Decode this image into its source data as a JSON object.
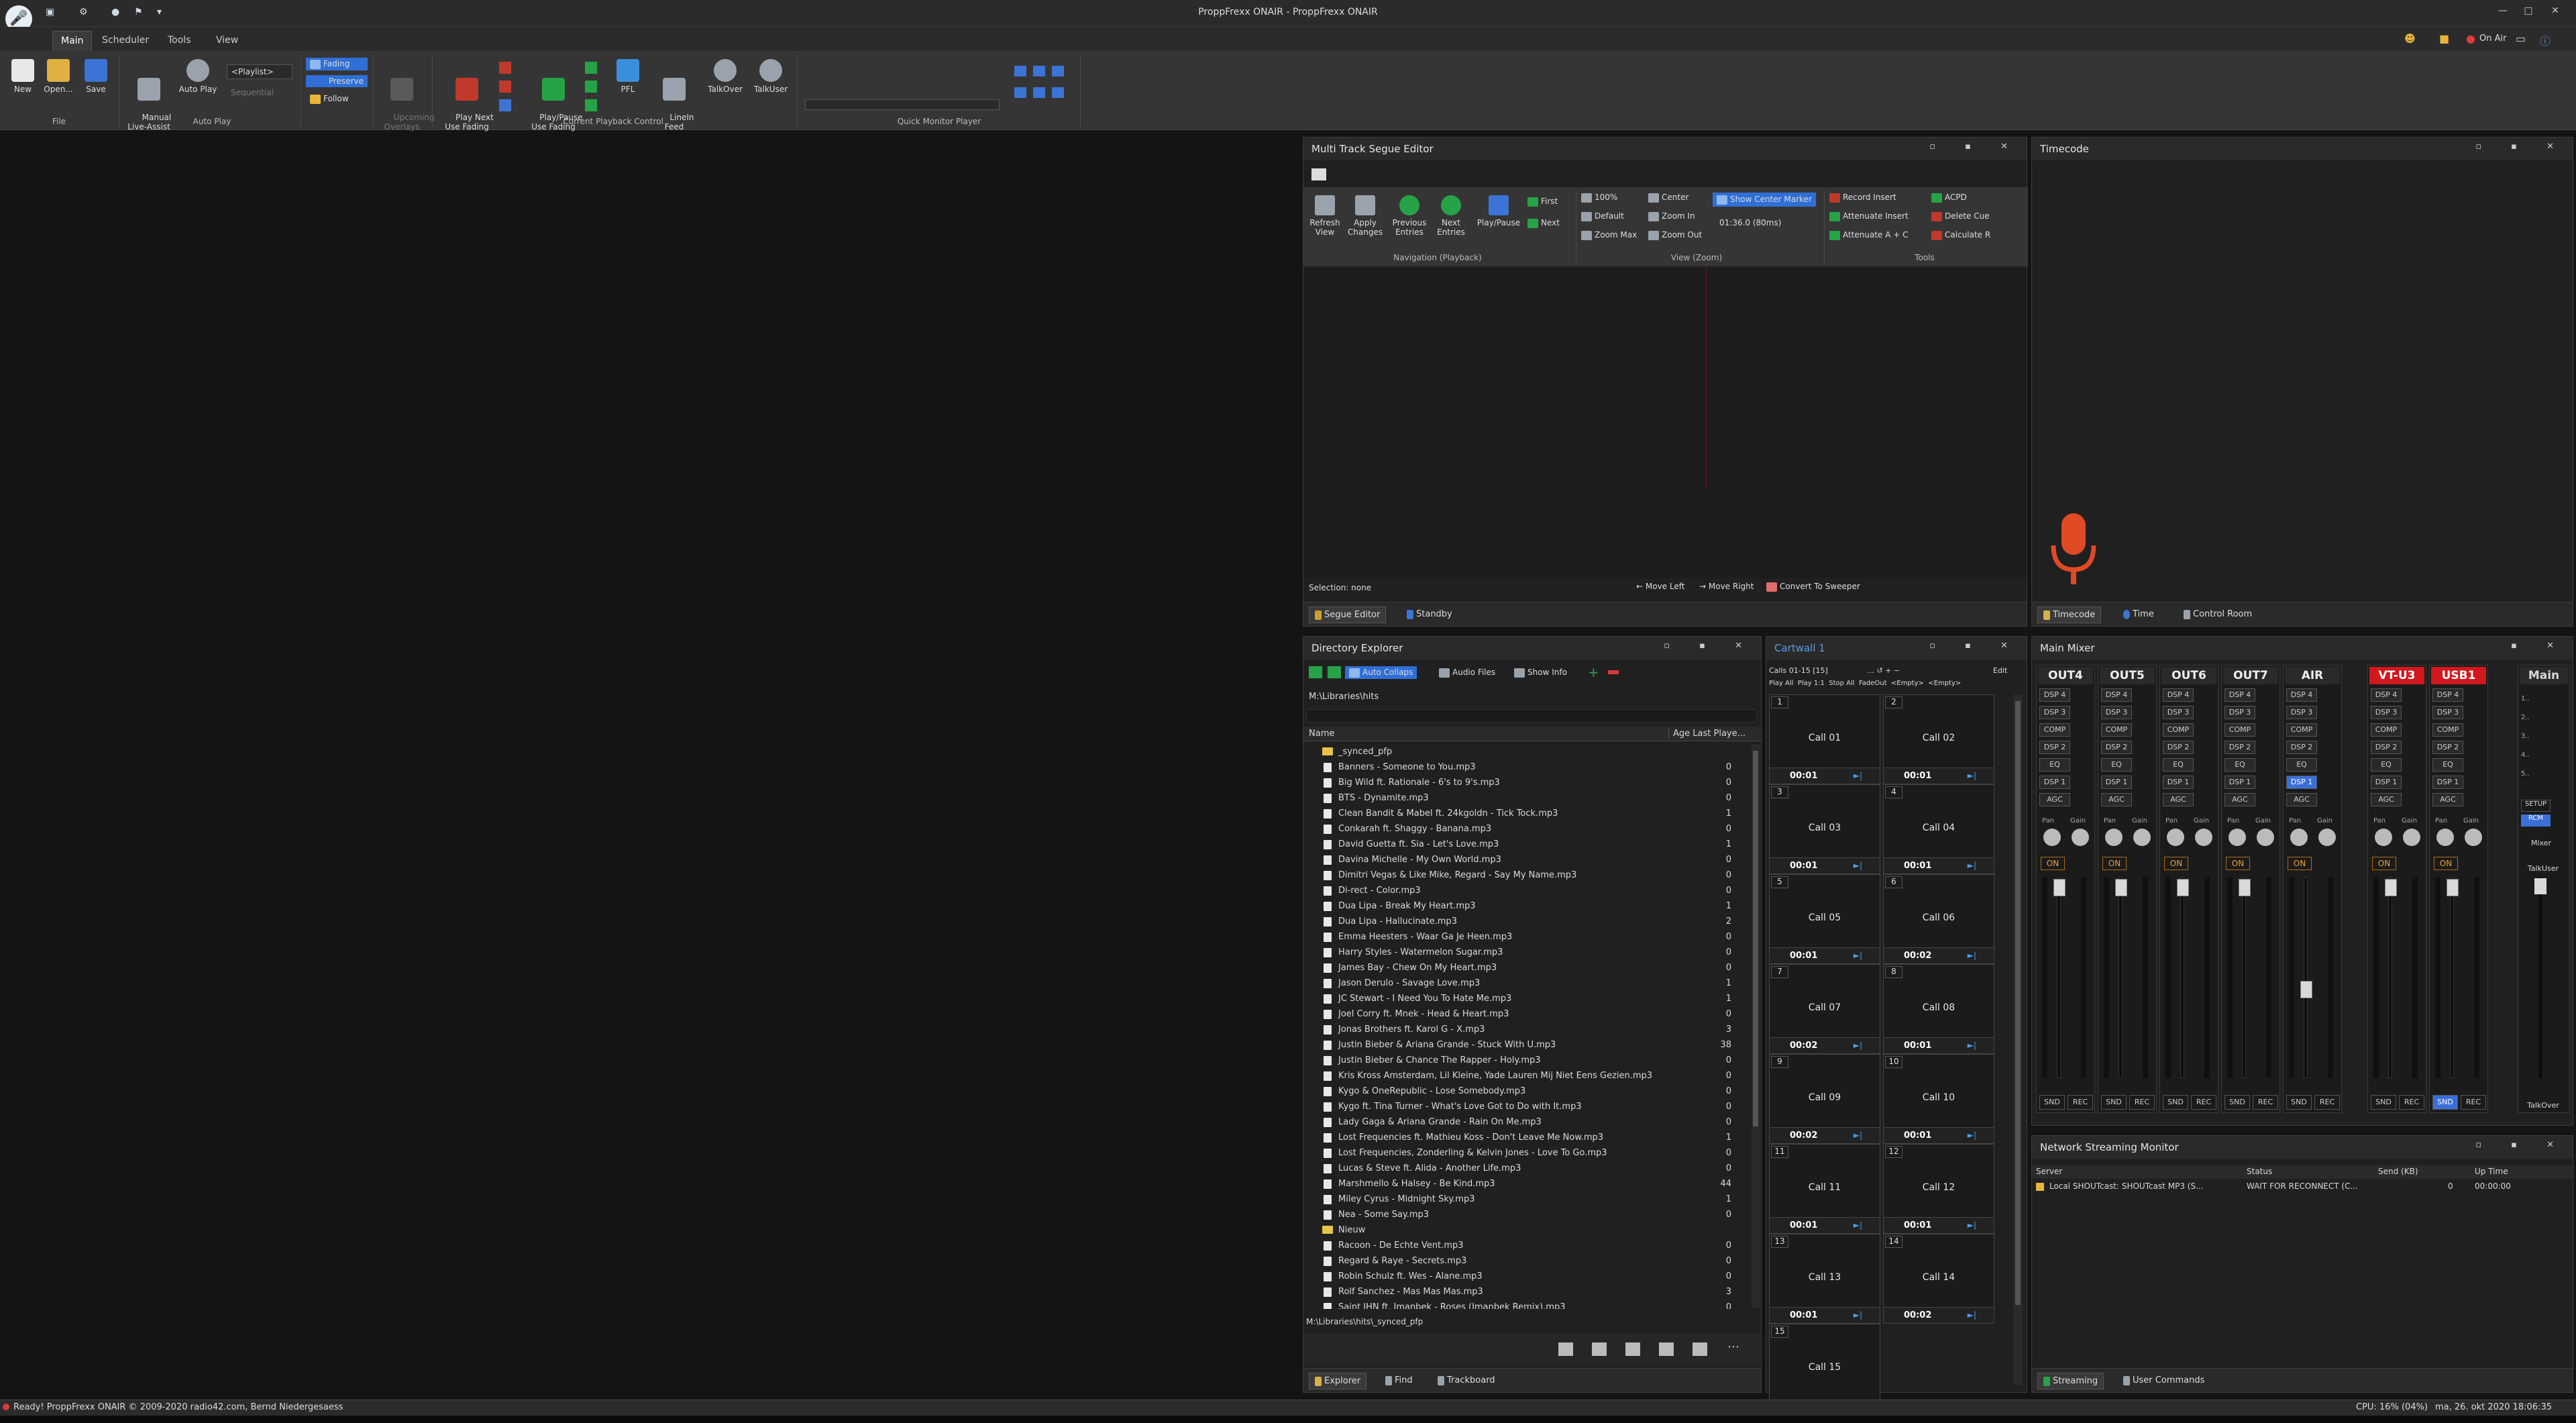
{
  "window": {
    "title": "ProppFrexx ONAIR - ProppFrexx ONAIR",
    "controls": [
      "—",
      "□",
      "✕"
    ]
  },
  "header_right": {
    "onair": "On Air"
  },
  "menu_tabs": [
    "Main",
    "Scheduler",
    "Tools",
    "View"
  ],
  "ribbon": {
    "file": {
      "new": "New",
      "open": "Open...",
      "save": "Save",
      "group": "File"
    },
    "autoplay": {
      "manual": "Manual\nLive-Assist",
      "autoplay": "Auto Play",
      "playlist": "<Playlist>",
      "sequential": "Sequential",
      "group": "Auto Play"
    },
    "fading": {
      "fading": "Fading",
      "preserve": "Preserve",
      "follow": "Follow"
    },
    "overlays": {
      "label": "Upcoming\nOverlays"
    },
    "playback": {
      "playnext": "Play Next\nUse Fading",
      "playpause": "Play/Pause\nUse Fading",
      "pfl": "PFL",
      "linein": "LineIn\nFeed",
      "group": "Current Playback Control"
    },
    "talk": {
      "talkover": "TalkOver",
      "talkuser": "TalkUser"
    },
    "monitor": {
      "group": "Quick Monitor Player"
    }
  },
  "segue": {
    "title": "Multi Track Segue Editor",
    "nav": {
      "refresh": "Refresh\nView",
      "apply": "Apply\nChanges",
      "previous": "Previous\nEntries",
      "next": "Next\nEntries",
      "playpause": "Play/Pause",
      "first": "First",
      "nextbtn": "Next",
      "group": "Navigation (Playback)"
    },
    "zoom": {
      "z100": "100%",
      "default": "Default",
      "zoommax": "Zoom Max",
      "center": "Center",
      "zoomin": "Zoom In",
      "zoomout": "Zoom Out",
      "show_center": "Show Center Marker",
      "time": "01:36.0 (80ms)",
      "group": "View (Zoom)"
    },
    "tools": {
      "record": "Record Insert",
      "acpd": "ACPD",
      "att_insert": "Attenuate Insert",
      "delete": "Delete Cue",
      "att_ac": "Attenuate A + C",
      "calc": "Calculate R",
      "group": "Tools"
    },
    "selection": "Selection: none",
    "move_left": "Move Left",
    "move_right": "Move Right",
    "convert": "Convert To Sweeper",
    "tabs": [
      "Segue Editor",
      "Standby"
    ]
  },
  "timecode": {
    "title": "Timecode",
    "tabs": [
      "Timecode",
      "Time",
      "Control Room"
    ]
  },
  "explorer": {
    "title": "Directory Explorer",
    "auto_collapse": "Auto Collaps",
    "audio_files": "Audio Files",
    "show_info": "Show Info",
    "path": "M:\\Libraries\\hits",
    "col_name": "Name",
    "col_age": "Age Last Playe...",
    "files": [
      {
        "name": "_synced_pfp",
        "age": "",
        "folder": true
      },
      {
        "name": "Banners - Someone to You.mp3",
        "age": "0"
      },
      {
        "name": "Big Wild ft. Rationale - 6's to 9's.mp3",
        "age": "0"
      },
      {
        "name": "BTS - Dynamite.mp3",
        "age": "0"
      },
      {
        "name": "Clean Bandit & Mabel ft. 24kgoldn - Tick Tock.mp3",
        "age": "1"
      },
      {
        "name": "Conkarah ft. Shaggy - Banana.mp3",
        "age": "0"
      },
      {
        "name": "David Guetta ft. Sia - Let's Love.mp3",
        "age": "1"
      },
      {
        "name": "Davina Michelle - My Own World.mp3",
        "age": "0"
      },
      {
        "name": "Dimitri Vegas & Like Mike, Regard - Say My Name.mp3",
        "age": "0"
      },
      {
        "name": "Di-rect - Color.mp3",
        "age": "0"
      },
      {
        "name": "Dua Lipa - Break My Heart.mp3",
        "age": "1"
      },
      {
        "name": "Dua Lipa - Hallucinate.mp3",
        "age": "2"
      },
      {
        "name": "Emma Heesters - Waar Ga Je Heen.mp3",
        "age": "0"
      },
      {
        "name": "Harry Styles - Watermelon Sugar.mp3",
        "age": "0"
      },
      {
        "name": "James Bay - Chew On My Heart.mp3",
        "age": "0"
      },
      {
        "name": "Jason Derulo - Savage Love.mp3",
        "age": "1"
      },
      {
        "name": "JC Stewart - I Need You To Hate Me.mp3",
        "age": "1"
      },
      {
        "name": "Joel Corry ft. Mnek - Head & Heart.mp3",
        "age": "0"
      },
      {
        "name": "Jonas Brothers ft. Karol G - X.mp3",
        "age": "3"
      },
      {
        "name": "Justin Bieber & Ariana Grande - Stuck With U.mp3",
        "age": "38"
      },
      {
        "name": "Justin Bieber & Chance The Rapper - Holy.mp3",
        "age": "0"
      },
      {
        "name": "Kris Kross Amsterdam, Lil Kleine, Yade Lauren Mij Niet Eens Gezien.mp3",
        "age": "0"
      },
      {
        "name": "Kygo & OneRepublic - Lose Somebody.mp3",
        "age": "0"
      },
      {
        "name": "Kygo ft. Tina Turner - What's Love Got to Do with It.mp3",
        "age": "0"
      },
      {
        "name": "Lady Gaga & Ariana Grande - Rain On Me.mp3",
        "age": "0"
      },
      {
        "name": "Lost Frequencies ft. Mathieu Koss - Don't Leave Me Now.mp3",
        "age": "1"
      },
      {
        "name": "Lost Frequencies, Zonderling & Kelvin Jones - Love To Go.mp3",
        "age": "0"
      },
      {
        "name": "Lucas & Steve ft. Alida - Another Life.mp3",
        "age": "0"
      },
      {
        "name": "Marshmello & Halsey - Be Kind.mp3",
        "age": "44"
      },
      {
        "name": "Miley Cyrus - Midnight Sky.mp3",
        "age": "1"
      },
      {
        "name": "Nea - Some Say.mp3",
        "age": "0"
      },
      {
        "name": "Nieuw",
        "age": "",
        "folder": true
      },
      {
        "name": "Racoon - De Echte Vent.mp3",
        "age": "0"
      },
      {
        "name": "Regard & Raye - Secrets.mp3",
        "age": "0"
      },
      {
        "name": "Robin Schulz ft. Wes - Alane.mp3",
        "age": "0"
      },
      {
        "name": "Rolf Sanchez - Mas Mas Mas.mp3",
        "age": "3"
      },
      {
        "name": "Saint JHN ft. Imanbek - Roses (Imanbek Remix).mp3",
        "age": "0"
      }
    ],
    "footer_path": "M:\\Libraries\\hits\\_synced_pfp",
    "tabs": [
      "Explorer",
      "Find",
      "Trackboard"
    ]
  },
  "cartwall": {
    "title": "Cartwall 1",
    "range": "Calls 01-15 [15]",
    "edit": "Edit",
    "toolbar2": "Play All  Play 1:1  Stop All  FadeOut  <Empty>  <Empty>",
    "cells": [
      {
        "no": "1",
        "name": "Call 01",
        "time": "00:01"
      },
      {
        "no": "2",
        "name": "Call 02",
        "time": "00:01"
      },
      {
        "no": "3",
        "name": "Call 03",
        "time": "00:01"
      },
      {
        "no": "4",
        "name": "Call 04",
        "time": "00:01"
      },
      {
        "no": "5",
        "name": "Call 05",
        "time": "00:01"
      },
      {
        "no": "6",
        "name": "Call 06",
        "time": "00:02"
      },
      {
        "no": "7",
        "name": "Call 07",
        "time": "00:02"
      },
      {
        "no": "8",
        "name": "Call 08",
        "time": "00:01"
      },
      {
        "no": "9",
        "name": "Call 09",
        "time": "00:02"
      },
      {
        "no": "10",
        "name": "Call 10",
        "time": "00:01"
      },
      {
        "no": "11",
        "name": "Call 11",
        "time": "00:01"
      },
      {
        "no": "12",
        "name": "Call 12",
        "time": "00:01"
      },
      {
        "no": "13",
        "name": "Call 13",
        "time": "00:01"
      },
      {
        "no": "14",
        "name": "Call 14",
        "time": "00:02"
      },
      {
        "no": "15",
        "name": "Call 15",
        "time": ""
      }
    ]
  },
  "mixer": {
    "title": "Main Mixer",
    "channels": [
      {
        "name": "OUT4",
        "red": false,
        "dsp_active": false,
        "snd_active": false
      },
      {
        "name": "OUT5",
        "red": false,
        "dsp_active": false,
        "snd_active": false
      },
      {
        "name": "OUT6",
        "red": false,
        "dsp_active": false,
        "snd_active": false
      },
      {
        "name": "OUT7",
        "red": false,
        "dsp_active": false,
        "snd_active": false
      },
      {
        "name": "AIR",
        "red": false,
        "dsp_active": true,
        "snd_active": false
      },
      {
        "name": "VT-U3",
        "red": true,
        "dsp_active": false,
        "snd_active": false
      },
      {
        "name": "USB1",
        "red": true,
        "dsp_active": false,
        "snd_active": true
      }
    ],
    "inserts": [
      "DSP 4",
      "DSP 3",
      "COMP",
      "DSP 2",
      "EQ",
      "DSP 1",
      "AGC"
    ],
    "pan": "Pan",
    "gain": "Gain",
    "on": "ON",
    "snd": "SND",
    "rec": "REC",
    "main": {
      "name": "Main",
      "setup": "SETUP",
      "rcm": "RCM",
      "mixer": "Mixer",
      "talkuser": "TalkUser",
      "talkover": "TalkOver",
      "scale": [
        "1..",
        "2..",
        "3..",
        "4..",
        "5.."
      ]
    }
  },
  "netmon": {
    "title": "Network Streaming Monitor",
    "cols": [
      "Server",
      "Status",
      "Send (KB)",
      "Up Time"
    ],
    "row": {
      "server": "Local SHOUTcast: SHOUTcast MP3 (S...",
      "status": "WAIT FOR RECONNECT (C...",
      "send": "0",
      "uptime": "00:00:00"
    },
    "tabs": [
      "Streaming",
      "User Commands"
    ]
  },
  "status": {
    "left": "Ready!  ProppFrexx ONAIR © 2009-2020 radio42.com, Bernd Niedergesaess",
    "cpu": "CPU: 16% (04%)",
    "datetime": "ma, 26. okt 2020 18:06:35"
  },
  "colors": {
    "accent": "#2f6fd6",
    "red": "#d1181e",
    "orange": "#e9a236"
  }
}
